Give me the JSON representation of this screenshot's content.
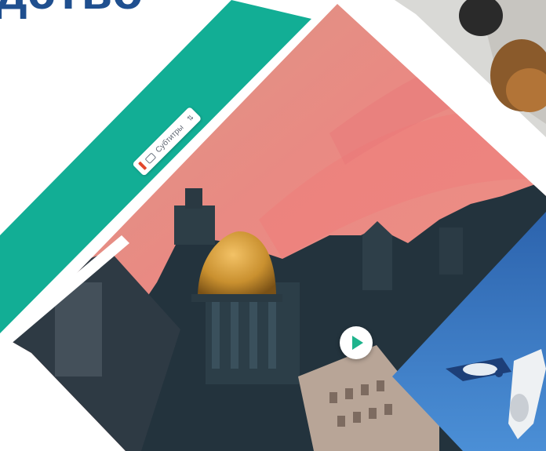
{
  "header": {
    "headline_fragment": "дство"
  },
  "video": {
    "subtitles_label": "Субтитры",
    "play_icon": "play-icon",
    "subtitles_icon": "subtitles-icon"
  },
  "colors": {
    "accent_green": "#1eb38c",
    "headline_blue": "#1f4f8f",
    "sky_pink": "#e98a83",
    "plane_sky": "#2b6fc2"
  }
}
